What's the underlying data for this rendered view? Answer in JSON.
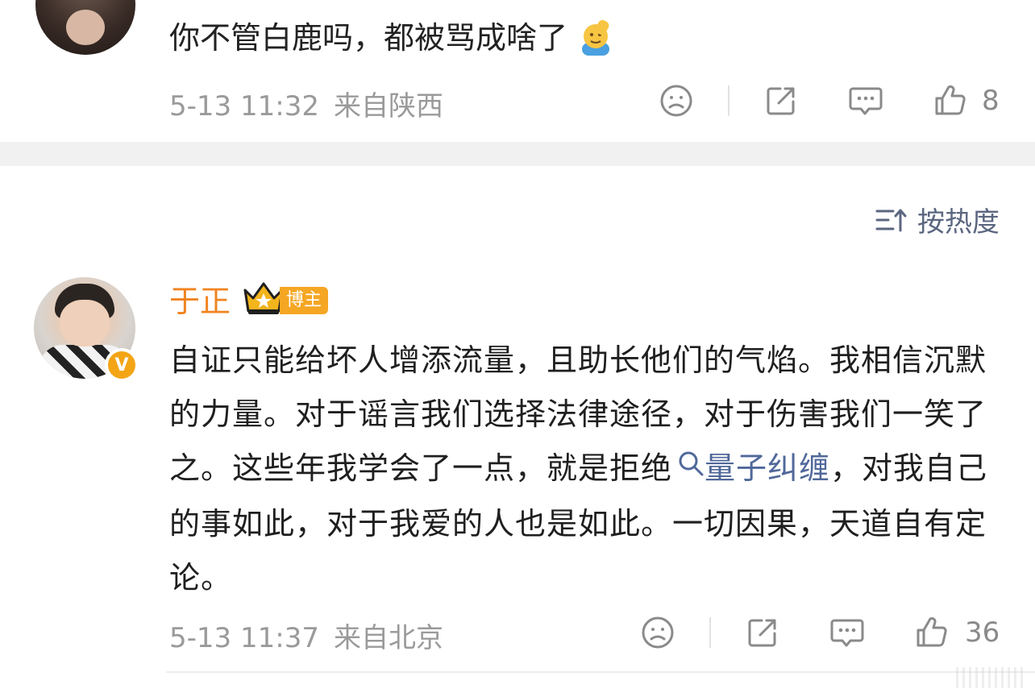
{
  "comment_top": {
    "text": "你不管白鹿吗，都被骂成啥了",
    "emoji": "saluting-face-icon",
    "time": "5-13 11:32",
    "location": "来自陕西",
    "likes": "8"
  },
  "sort": {
    "label": "按热度",
    "icon": "sort-icon"
  },
  "comment_main": {
    "username": "于正",
    "badge": "博主",
    "verified_icon": "v-verified-icon",
    "text_part1": "自证只能给坏人增添流量，且助长他们的气焰。我相信沉默的力量。对于谣言我们选择法律途径，对于伤害我们一笑了之。这些年我学会了一点，就是拒绝",
    "topic": "量子纠缠",
    "text_part2": "，对我自己的事如此，对于我爱的人也是如此。一切因果，天道自有定论。",
    "time": "5-13 11:37",
    "location": "来自北京",
    "likes": "36"
  },
  "colors": {
    "username": "#f08420",
    "topic": "#50689a",
    "meta": "#9a9a9a",
    "badge_bg": "#f5a623"
  }
}
